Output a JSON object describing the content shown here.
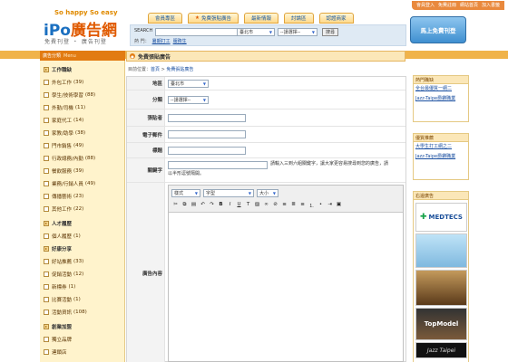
{
  "header": {
    "slogan": "So happy So easy",
    "brand_ipo": "iPo",
    "brand_cn": "廣告網",
    "tagline": "免費刊登 ・ 廣告刊登",
    "top_links": [
      "會員登入",
      "免費註冊",
      "網站首頁",
      "加入書籤"
    ],
    "nav_tabs": [
      "會員專區",
      "免費張貼廣告",
      "最新情報",
      "討論區",
      "認證商家"
    ],
    "free_post": "馬上免費刊登"
  },
  "search": {
    "label": "SEARCH",
    "hot_label": "熱 門：",
    "hot_links": [
      "暑期打工",
      "服務生"
    ],
    "city": "臺北市",
    "category": "--請選擇--",
    "button": "搜尋"
  },
  "sidebar": {
    "title": "廣告分類",
    "title_en": "Menu",
    "items": [
      {
        "label": "工作職缺",
        "count": "",
        "type": "cat"
      },
      {
        "label": "外包工作",
        "count": "(39)",
        "type": "sub"
      },
      {
        "label": "學生/技術學習",
        "count": "(88)",
        "type": "sub"
      },
      {
        "label": "外勤/司機",
        "count": "(11)",
        "type": "sub"
      },
      {
        "label": "家庭代工",
        "count": "(14)",
        "type": "sub"
      },
      {
        "label": "家教/助學",
        "count": "(38)",
        "type": "sub"
      },
      {
        "label": "門市銷售",
        "count": "(49)",
        "type": "sub"
      },
      {
        "label": "行政總務/內勤",
        "count": "(88)",
        "type": "sub"
      },
      {
        "label": "餐飲服務",
        "count": "(39)",
        "type": "sub"
      },
      {
        "label": "業務/行銷人員",
        "count": "(49)",
        "type": "sub"
      },
      {
        "label": "傳播藝術",
        "count": "(23)",
        "type": "sub"
      },
      {
        "label": "其他工作",
        "count": "(22)",
        "type": "sub"
      },
      {
        "label": "人才履歷",
        "count": "",
        "type": "cat"
      },
      {
        "label": "個人履歷",
        "count": "(1)",
        "type": "sub"
      },
      {
        "label": "好康分享",
        "count": "",
        "type": "cat"
      },
      {
        "label": "好站推薦",
        "count": "(33)",
        "type": "sub"
      },
      {
        "label": "促銷活動",
        "count": "(12)",
        "type": "sub"
      },
      {
        "label": "新標券",
        "count": "(1)",
        "type": "sub"
      },
      {
        "label": "比賽活動",
        "count": "(1)",
        "type": "sub"
      },
      {
        "label": "活動資訊",
        "count": "(108)",
        "type": "sub"
      },
      {
        "label": "創業加盟",
        "count": "",
        "type": "cat"
      },
      {
        "label": "獨立品牌",
        "count": "",
        "type": "sub"
      },
      {
        "label": "連鎖店",
        "count": "",
        "type": "sub"
      }
    ]
  },
  "main": {
    "title": "免費張貼廣告",
    "breadcrumb_prefix": "目前位置：",
    "breadcrumb_home": "首頁",
    "breadcrumb_current": "免費張貼廣告",
    "form": {
      "region_label": "地區",
      "region_value": "臺北市",
      "category_label": "分類",
      "category_value": "--請選擇--",
      "poster_label": "張貼者",
      "email_label": "電子郵件",
      "subject_label": "標題",
      "keyword_label": "關鍵字",
      "keyword_hint_1": "請輸入三到六組關鍵字，讓大家更容易搜尋到您的廣告，請",
      "keyword_hint_2": "以半形逗號隔開。",
      "content_label": "廣告內容",
      "editor_style": "樣式",
      "editor_font": "字型",
      "editor_size": "大小"
    }
  },
  "right": {
    "hot_title": "熱門職缺",
    "hot_links": [
      "全台最優質一網二",
      "Jazz-Taipe爵鑽職業"
    ],
    "feature_title": "優質推薦",
    "feature_links": [
      "大學生打工網之二",
      "Jazz-Taipe爵鑽職業"
    ],
    "ad_title": "右邊廣告",
    "ad_medtecs": "MEDTECS",
    "ad_top": "TopModel",
    "ad_jazz": "Jazz Taipei"
  }
}
